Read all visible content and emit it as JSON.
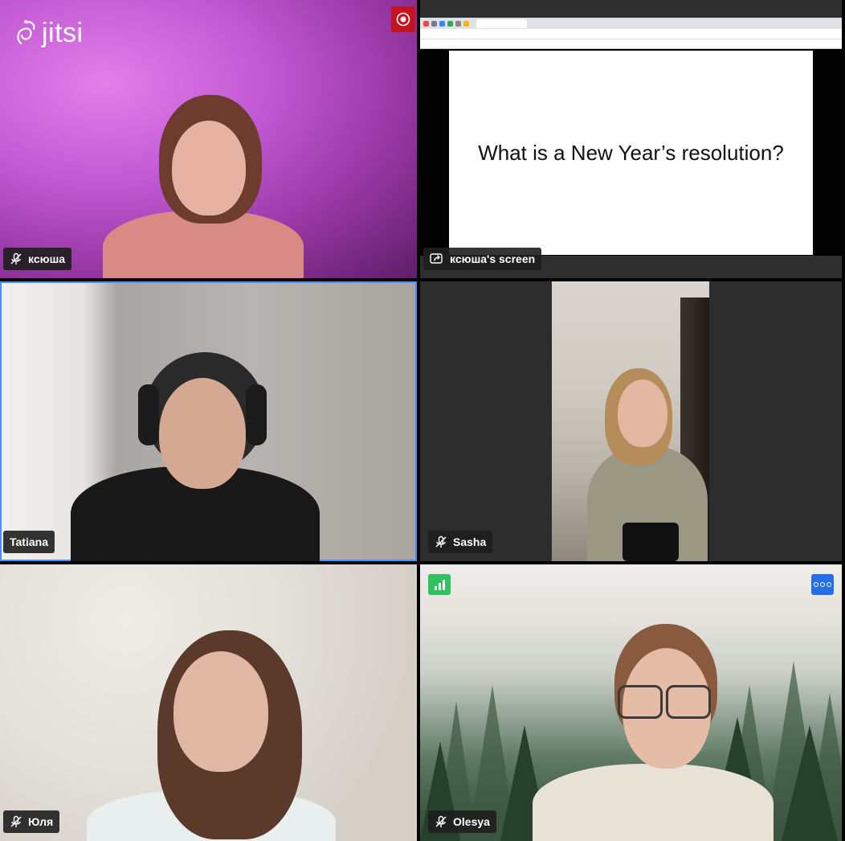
{
  "app": {
    "logo_text": "jitsi"
  },
  "tiles": [
    {
      "name": "ксюша",
      "muted": true
    },
    {
      "name": "ксюша's screen",
      "screen_share": true,
      "slide_text": "What is a New Year’s resolution?"
    },
    {
      "name": "Tatiana",
      "muted": false,
      "active_speaker": true
    },
    {
      "name": "Sasha",
      "muted": true
    },
    {
      "name": "Юля",
      "muted": true
    },
    {
      "name": "Olesya",
      "muted": true
    }
  ],
  "icons": {
    "recording": "record-icon",
    "mic_muted": "mic-muted-icon",
    "screen_share": "screen-share-icon",
    "connection": "connection-quality-icon",
    "more": "more-options-icon"
  },
  "colors": {
    "active_border": "#4c8ef7",
    "record_red": "#c4121f",
    "connection_green": "#31c25f",
    "more_blue": "#246fe5"
  }
}
